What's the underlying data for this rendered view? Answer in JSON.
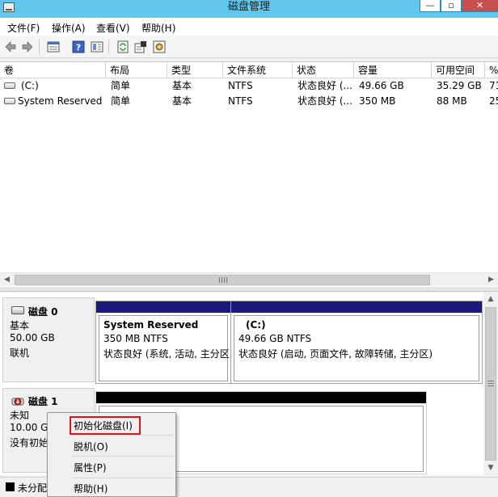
{
  "window": {
    "title": "磁盘管理",
    "min_glyph": "—",
    "max_glyph": "▫",
    "close_glyph": "✕",
    "close_color": "#c7504f",
    "titlebar_color": "#62c6ec"
  },
  "menu": [
    "文件(F)",
    "操作(A)",
    "查看(V)",
    "帮助(H)"
  ],
  "toolbar": {
    "icons": [
      "back-arrow-icon",
      "forward-arrow-icon",
      "properties-view-icon",
      "help-icon",
      "details-view-icon",
      "refresh-icon",
      "properties-icon",
      "settings-icon"
    ]
  },
  "volume_table": {
    "columns": [
      "卷",
      "布局",
      "类型",
      "文件系统",
      "状态",
      "容量",
      "可用空间",
      "%"
    ],
    "rows": [
      [
        "(C:)",
        "简单",
        "基本",
        "NTFS",
        "状态良好 (...",
        "49.66 GB",
        "35.29 GB",
        "71"
      ],
      [
        "System Reserved",
        "简单",
        "基本",
        "NTFS",
        "状态良好 (...",
        "350 MB",
        "88 MB",
        "25"
      ]
    ],
    "scroll_grip": "III"
  },
  "disks": [
    {
      "title": "磁盘 0",
      "type": "基本",
      "size": "50.00 GB",
      "status": "联机",
      "partitions": [
        {
          "name": "System Reserved",
          "size_fs": "350 MB NTFS",
          "status": "状态良好 (系统, 活动, 主分区"
        },
        {
          "name": "(C:)",
          "size_fs": "49.66 GB NTFS",
          "status": "状态良好 (启动, 页面文件, 故障转储, 主分区)"
        }
      ]
    },
    {
      "title": "磁盘 1",
      "type": "未知",
      "size": "10.00 GB",
      "status": "没有初始化"
    }
  ],
  "legend": {
    "label": "未分配",
    "color": "#000000"
  },
  "context_menu": {
    "items": [
      "初始化磁盘(I)",
      "脱机(O)",
      "属性(P)",
      "帮助(H)"
    ],
    "highlight_color": "#e0121b"
  }
}
